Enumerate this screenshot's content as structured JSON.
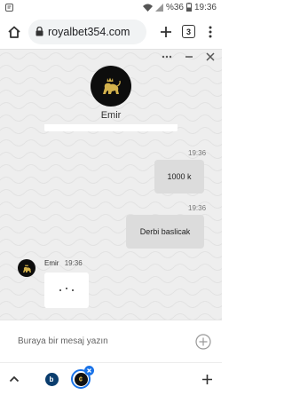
{
  "status_bar": {
    "battery_text": "%36",
    "time": "19:36"
  },
  "browser": {
    "url": "royalbet354.com",
    "tab_count": "3",
    "icons": [
      "home-icon",
      "lock-icon",
      "add-tab-icon",
      "tab-count-icon",
      "more-vert-icon"
    ]
  },
  "chat": {
    "background_color": "#eeeeee",
    "agent": {
      "name": "Emir",
      "avatar_icon": "lion-logo-icon"
    },
    "controls": [
      "more-horiz-icon",
      "minimize-icon",
      "close-icon"
    ],
    "messages": [
      {
        "direction": "out",
        "time": "19:36",
        "text": "1000 k"
      },
      {
        "direction": "out",
        "time": "19:36",
        "text": "Derbi baslicak"
      }
    ],
    "typing": {
      "name": "Emir",
      "time": "19:36"
    }
  },
  "composer": {
    "placeholder": "Buraya bir mesaj yazın",
    "add_icon": "add-circle-icon"
  },
  "bottom_bar": {
    "icons": [
      "chevron-up-icon",
      "tab-b-icon",
      "tab-bet-icon",
      "close-badge-icon",
      "add-icon"
    ],
    "tab1_letter": "b",
    "tab2_letter": "¢"
  }
}
